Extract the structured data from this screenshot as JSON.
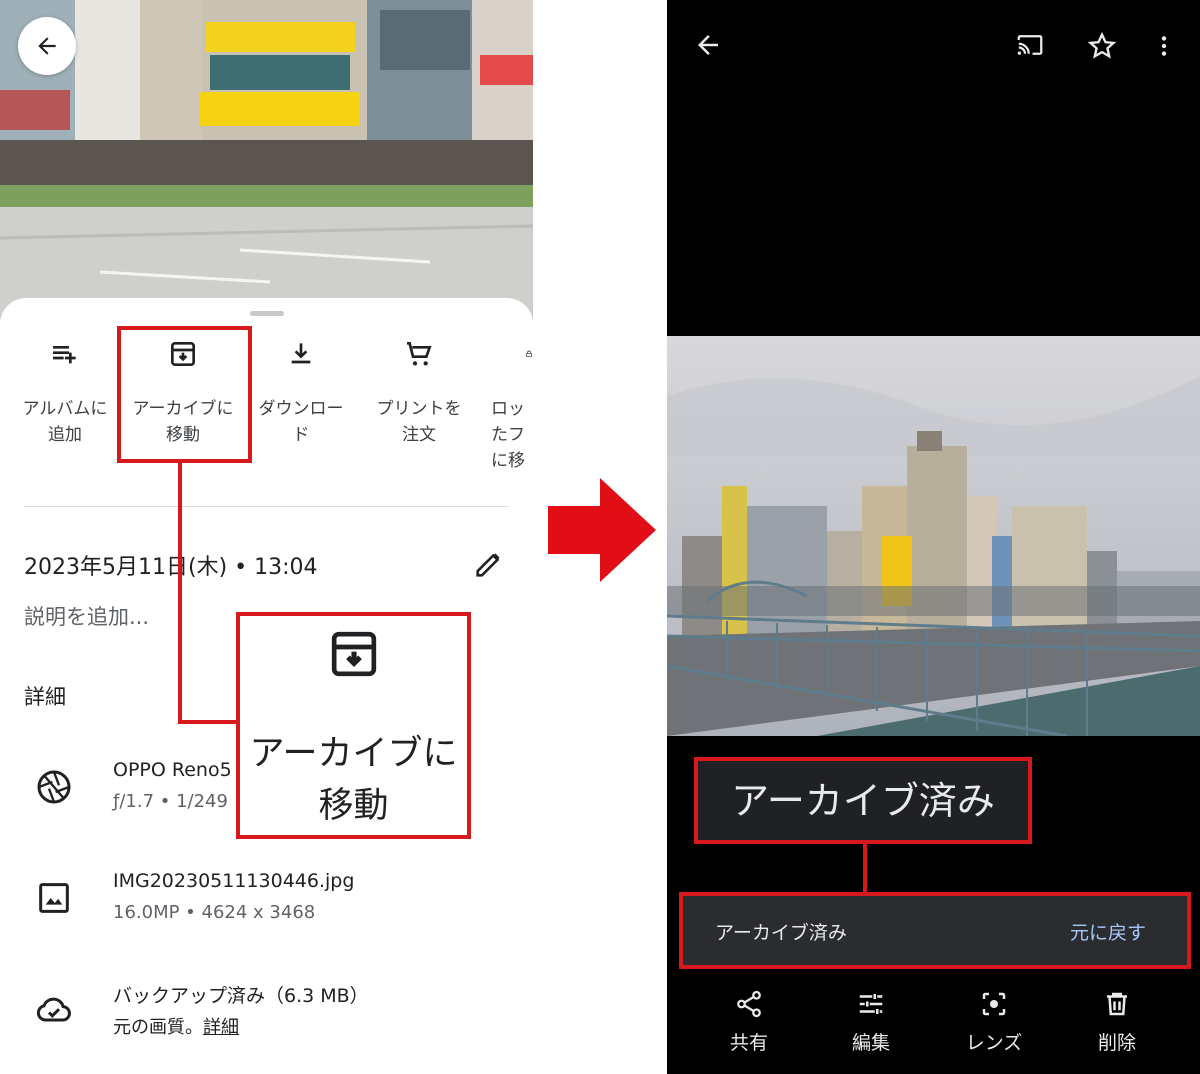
{
  "left": {
    "actions": [
      {
        "label": "アルバムに\n追加",
        "icon": "playlist-add-icon"
      },
      {
        "label": "アーカイブに\n移動",
        "icon": "archive-icon"
      },
      {
        "label": "ダウンロー\nド",
        "icon": "download-icon"
      },
      {
        "label": "プリントを\n注文",
        "icon": "cart-icon"
      },
      {
        "label": "ロッ\nたフ\nに移",
        "icon": "lock-icon"
      }
    ],
    "date": "2023年5月11日(木) • 13:04",
    "description_placeholder": "説明を追加...",
    "details_heading": "詳細",
    "camera": {
      "line1": "OPPO Reno5",
      "line2": "ƒ/1.7  •  1/249"
    },
    "file": {
      "line1": "IMG20230511130446.jpg",
      "line2": "16.0MP  •  4624 x 3468"
    },
    "backup": {
      "line1": "バックアップ済み（6.3 MB）",
      "line2_prefix": "元の画質。",
      "line2_link": "詳細"
    },
    "callout": {
      "text": "アーカイブに\n移動",
      "icon": "archive-icon"
    }
  },
  "right": {
    "toolbar_icons": [
      "back-arrow-icon",
      "cast-icon",
      "star-icon",
      "more-vert-icon"
    ],
    "archived_tag": "アーカイブ済み",
    "snackbar": {
      "message": "アーカイブ済み",
      "action": "元に戻す"
    },
    "bottom_actions": [
      {
        "label": "共有",
        "icon": "share-icon"
      },
      {
        "label": "編集",
        "icon": "tune-icon"
      },
      {
        "label": "レンズ",
        "icon": "lens-icon"
      },
      {
        "label": "削除",
        "icon": "delete-icon"
      }
    ]
  },
  "colors": {
    "highlight": "#d7191e",
    "snack_action": "#a8c7fa"
  }
}
